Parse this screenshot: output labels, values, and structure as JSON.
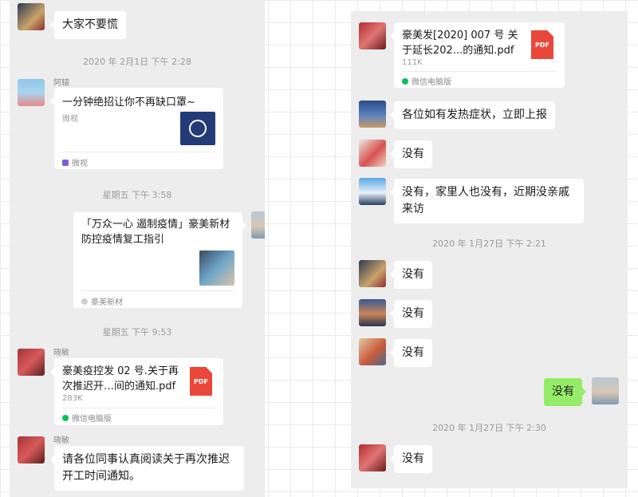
{
  "left_panel": {
    "msg1": {
      "text": "大家不要慌"
    },
    "ts1": "2020 年 2月1日 下午 2:28",
    "msg2": {
      "sender": "阿辕",
      "title": "一分钟绝招让你不再缺口罩~",
      "source": "微视",
      "footer": "微视"
    },
    "ts2": "星期五 下午 3:58",
    "msg3": {
      "title": "「万众一心 遏制疫情」豪美新材防控疫情复工指引",
      "footer": "豪美新材"
    },
    "ts3": "星期五 下午 9:53",
    "msg4": {
      "sender": "晓敏",
      "title": "豪美疫控发 02 号.关于再次推迟开…间的通知.pdf",
      "size": "283K",
      "icon_label": "PDF",
      "footer": "微信电脑版"
    },
    "msg5": {
      "sender": "晓敏",
      "text": "请各位同事认真阅读关于再次推迟开工时间通知。"
    }
  },
  "right_panel": {
    "msg1": {
      "title": "豪美发[2020] 007 号 关于延长202...的通知.pdf",
      "size": "111K",
      "icon_label": "PDF",
      "footer": "微信电脑版"
    },
    "msg2": {
      "text": "各位如有发热症状，立即上报"
    },
    "msg3": {
      "text": "没有"
    },
    "msg4": {
      "text": "没有，家里人也没有，近期没亲戚来访"
    },
    "ts1": "2020 年 1月27日 下午 2:21",
    "msg5": {
      "text": "没有"
    },
    "msg6": {
      "text": "没有"
    },
    "msg7": {
      "text": "没有"
    },
    "msg8": {
      "text": "没有"
    },
    "ts2": "2020 年 1月27日 下午 2:30",
    "msg9": {
      "text": "没有"
    }
  },
  "colors": {
    "chat_bg": "#ededed",
    "bubble_self": "#95ec69",
    "bubble_other": "#ffffff",
    "pdf_red": "#e9473a",
    "wechat_green": "#07c160"
  }
}
